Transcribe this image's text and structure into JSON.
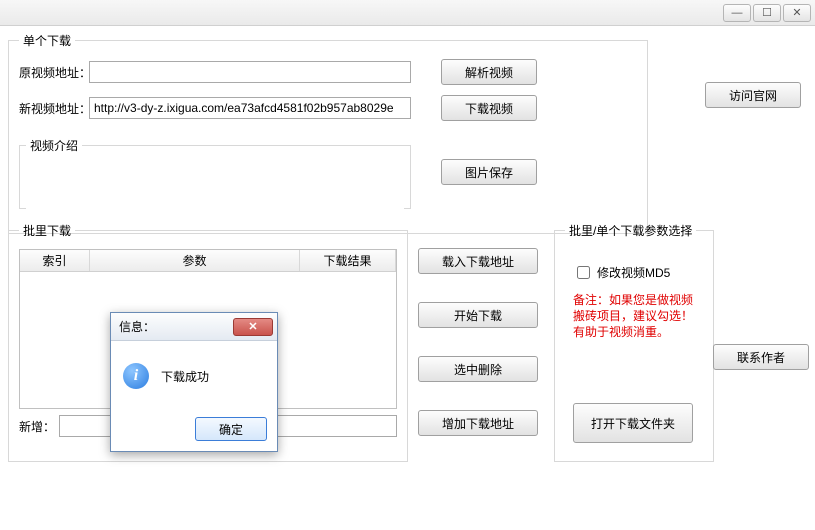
{
  "window": {
    "min_icon": "—",
    "max_icon": "☐",
    "close_icon": "✕"
  },
  "single": {
    "legend": "单个下载",
    "orig_label": "原视频地址：",
    "orig_value": "",
    "parse_btn": "解析视频",
    "new_label": "新视频地址：",
    "new_value": "http://v3-dy-z.ixigua.com/ea73afcd4581f02b957ab8029e",
    "download_btn": "下载视频",
    "intro_legend": "视频介绍",
    "intro_value": "",
    "save_img_btn": "图片保存",
    "visit_btn": "访问官网"
  },
  "batch": {
    "legend": "批里下载",
    "col_index": "索引",
    "col_param": "参数",
    "col_result": "下载结果",
    "add_label": "新增：",
    "add_value": "",
    "btn_load": "载入下载地址",
    "btn_start": "开始下载",
    "btn_delete": "选中删除",
    "btn_add": "增加下载地址"
  },
  "params": {
    "legend": "批里/单个下载参数选择",
    "chk_label": "修改视频MD5",
    "note": "备注：如果您是做视频搬砖项目，建议勾选！有助于视频消重。",
    "open_folder": "打开下载文件夹"
  },
  "contact_btn": "联系作者",
  "dialog": {
    "title": "信息：",
    "message": "下载成功",
    "ok": "确定"
  }
}
